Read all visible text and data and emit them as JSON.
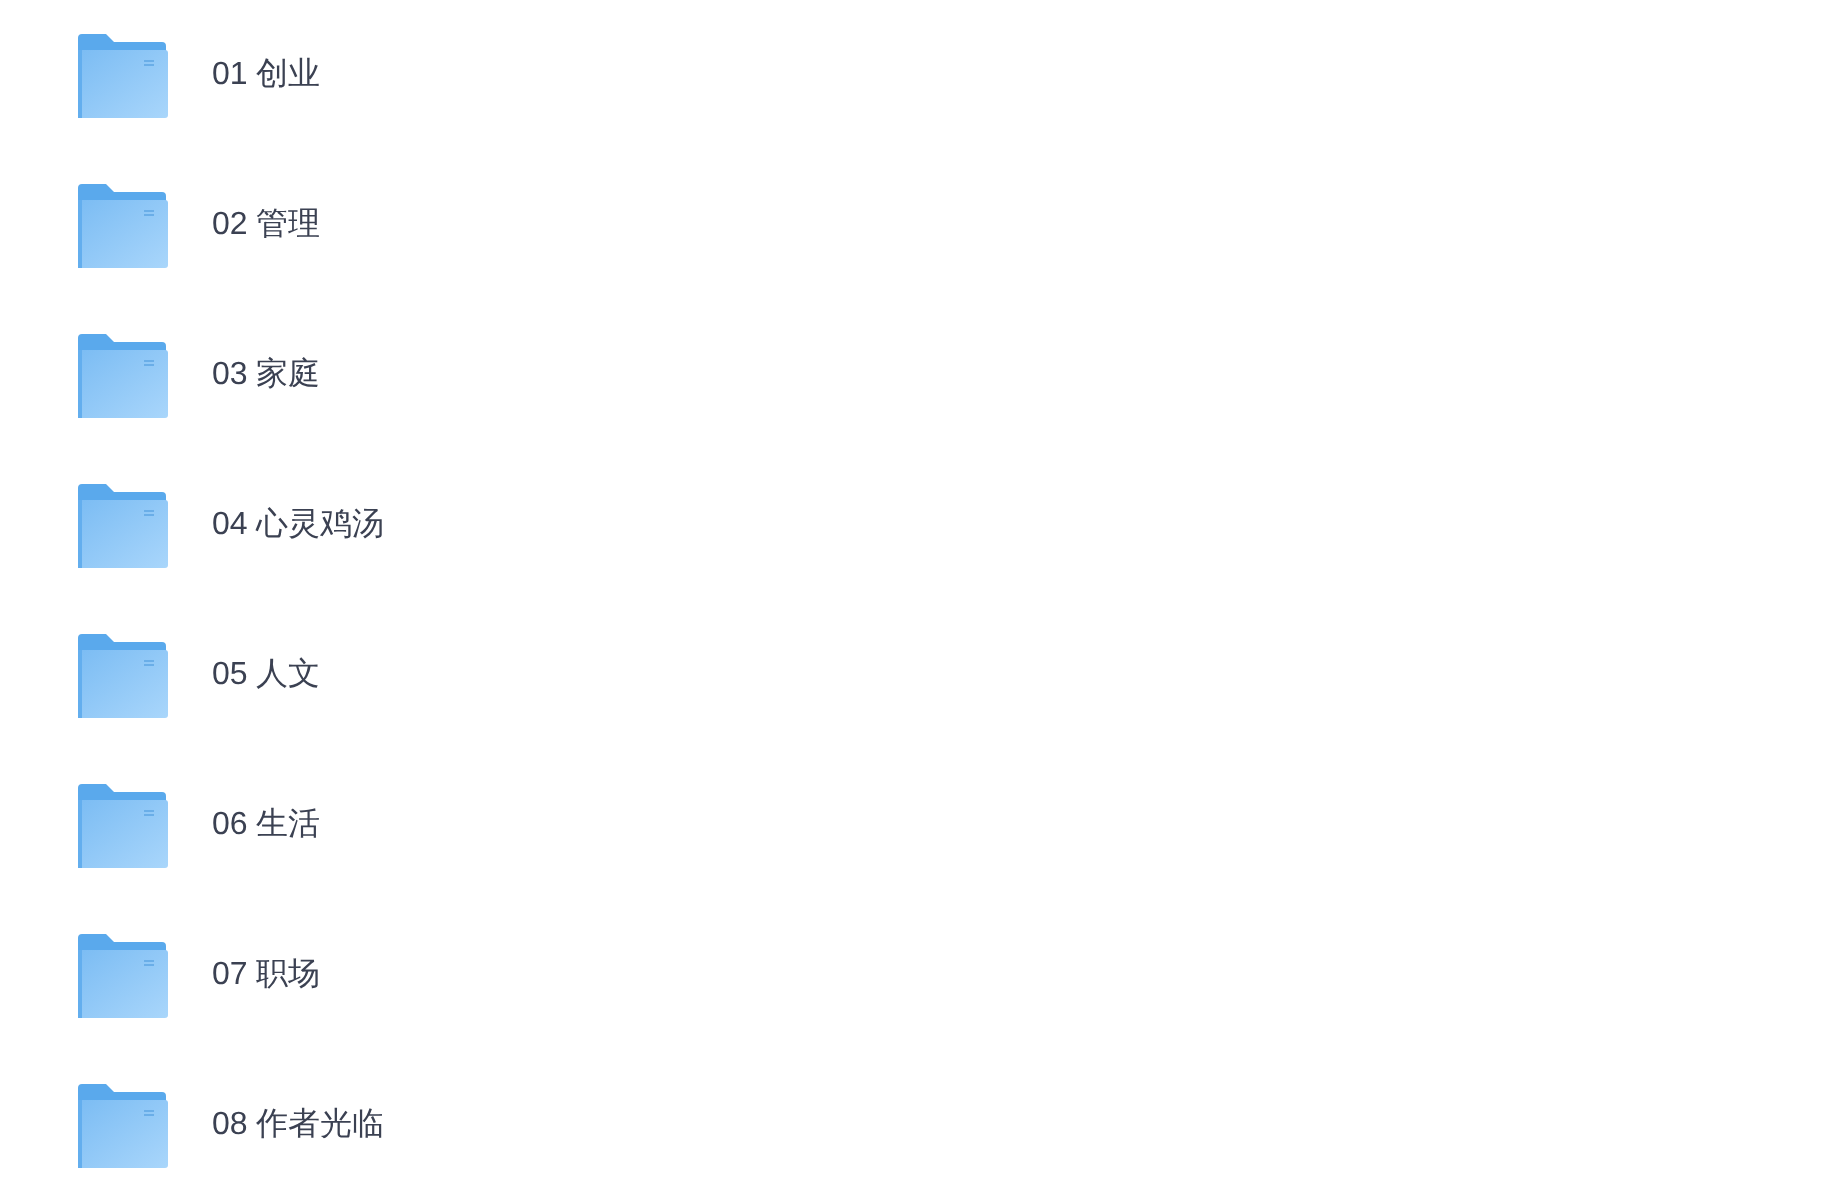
{
  "folders": [
    {
      "name": "01 创业"
    },
    {
      "name": "02 管理"
    },
    {
      "name": "03 家庭"
    },
    {
      "name": "04 心灵鸡汤"
    },
    {
      "name": "05 人文"
    },
    {
      "name": "06 生活"
    },
    {
      "name": "07 职场"
    },
    {
      "name": "08 作者光临"
    }
  ]
}
